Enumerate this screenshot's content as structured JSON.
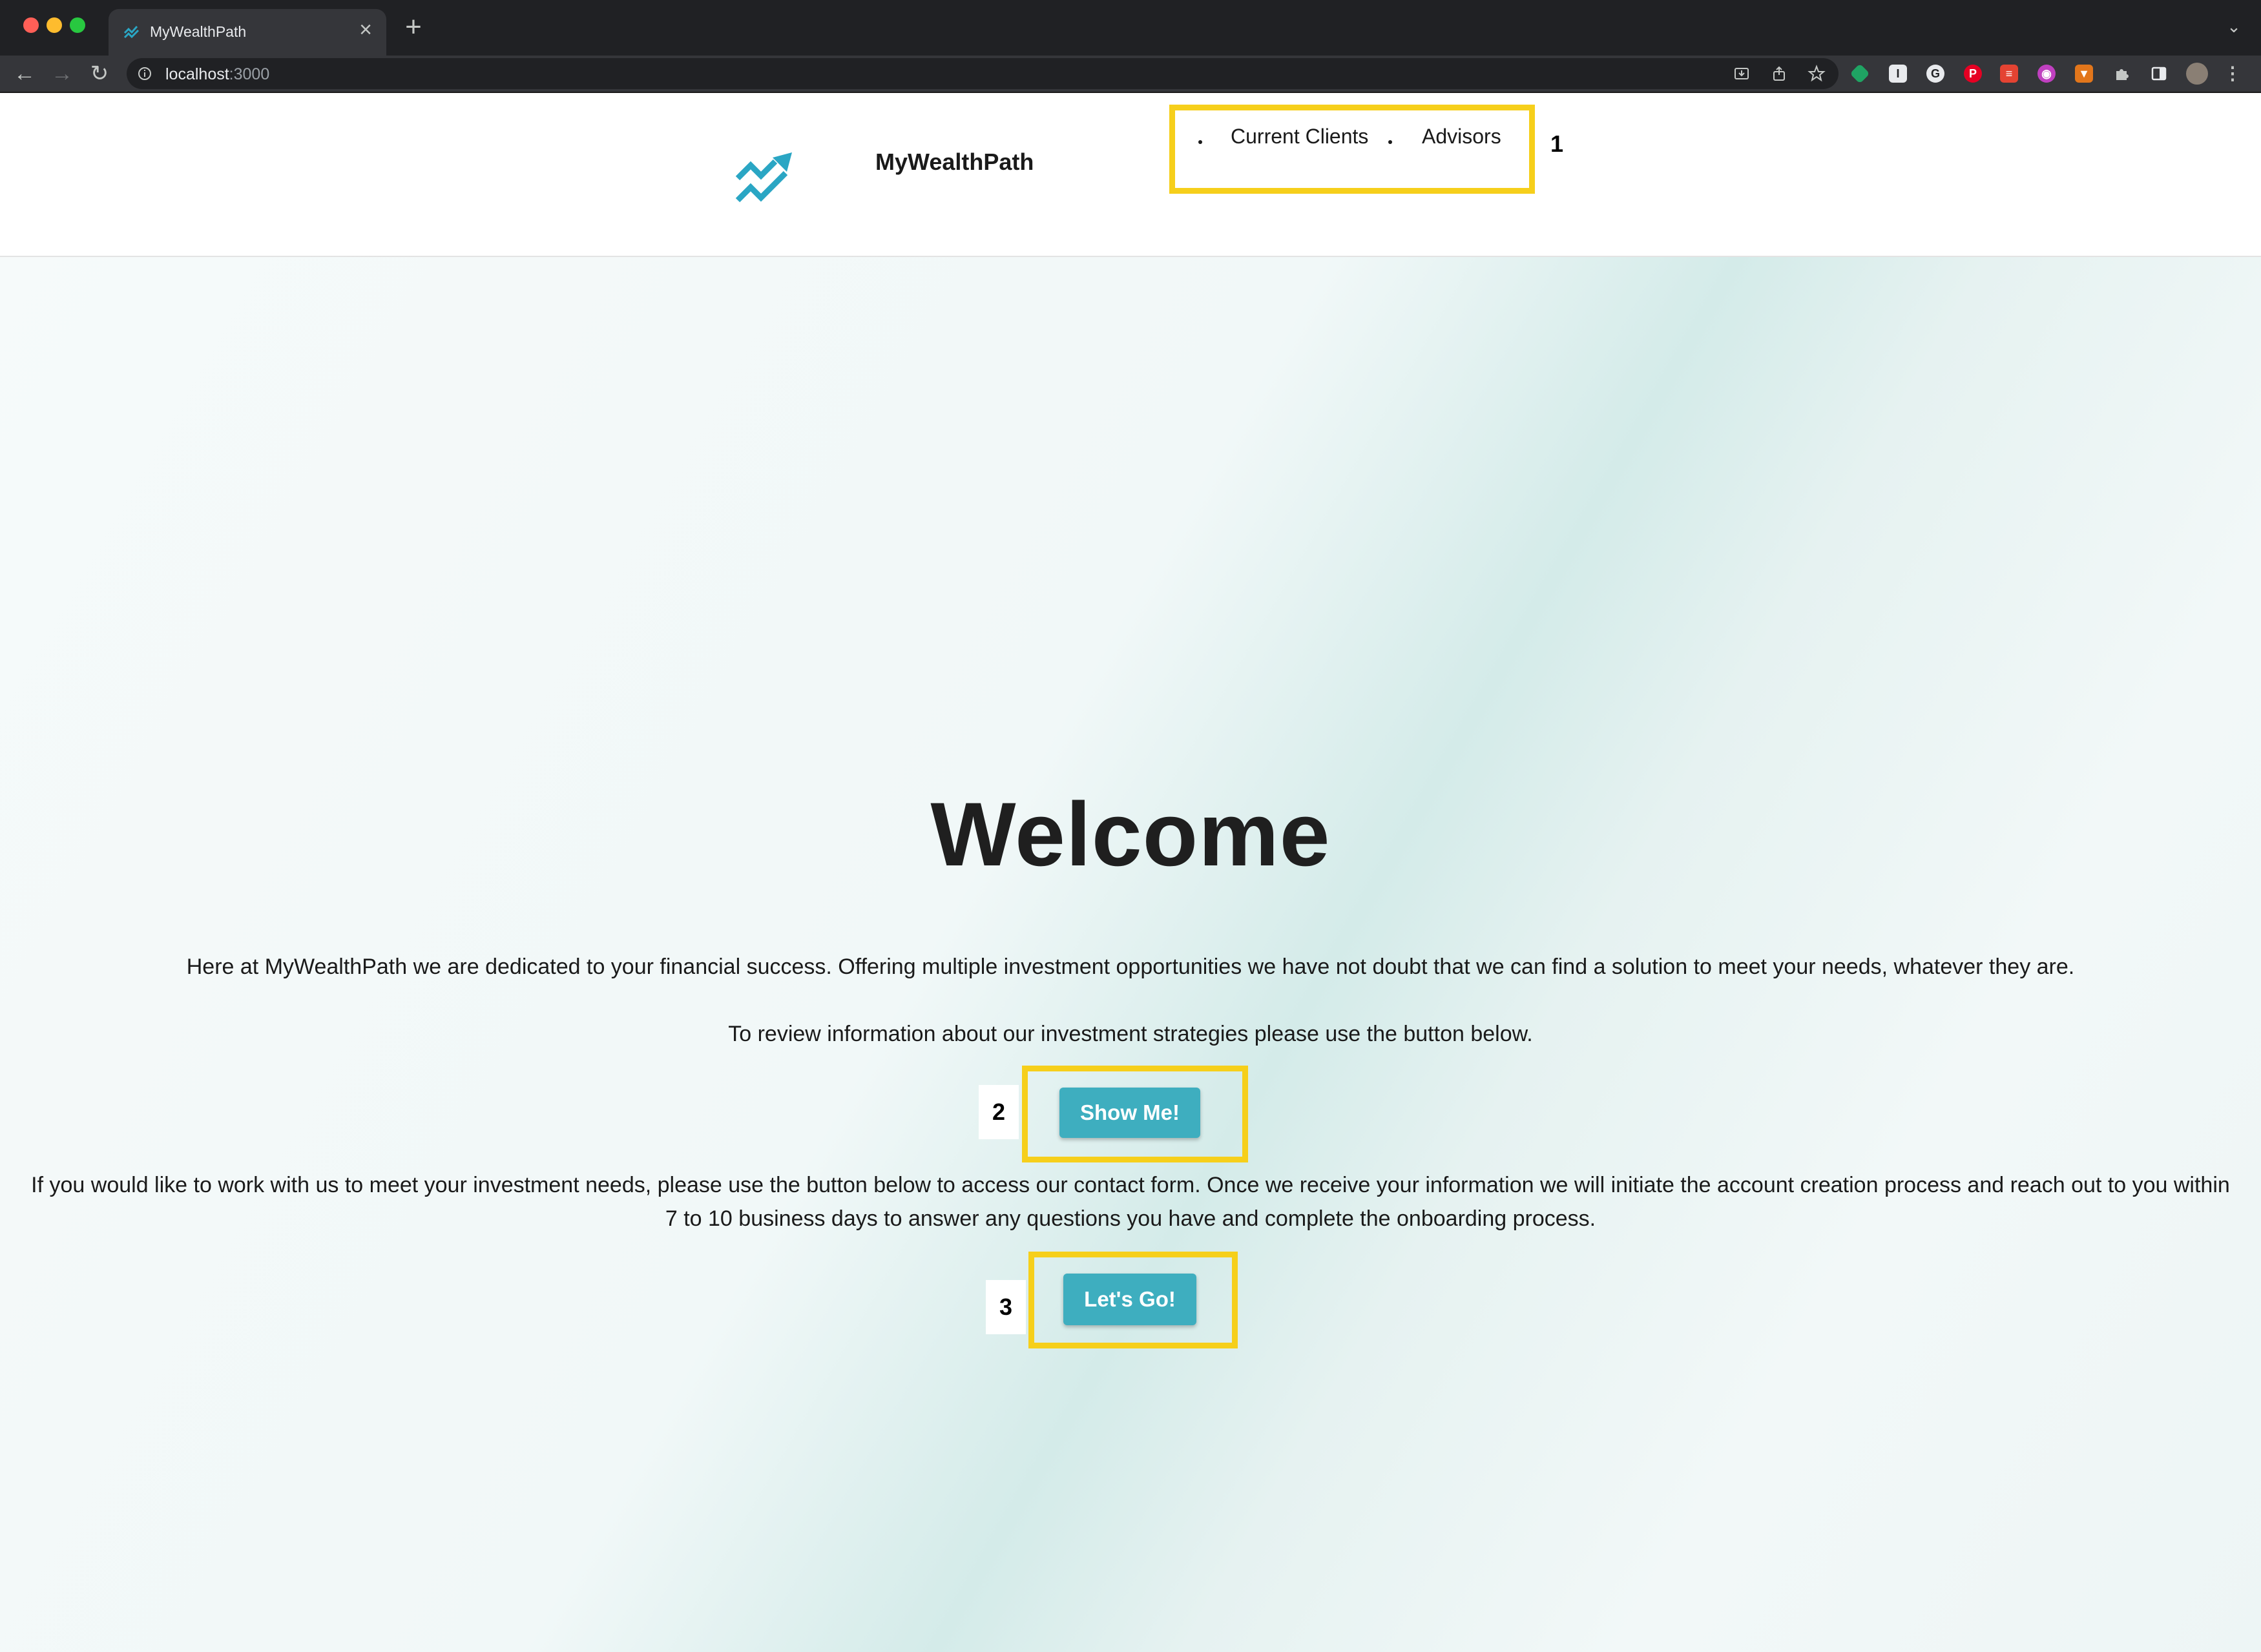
{
  "browser": {
    "tab_title": "MyWealthPath",
    "tab_close": "×",
    "new_tab": "+",
    "tab_dropdown": "⌄",
    "back": "←",
    "forward": "→",
    "reload": "↻",
    "url_host": "localhost",
    "url_port": ":3000",
    "toolbar_icons": [
      "install-icon",
      "share-icon",
      "star-icon"
    ],
    "extensions": [
      "green-ext",
      "I",
      "G",
      "P",
      "red-ext",
      "purple-ext",
      "fox-ext",
      "puzzle",
      "sidepanel",
      "avatar",
      "menu"
    ]
  },
  "header": {
    "brand": "MyWealthPath",
    "nav": [
      {
        "label": "Current Clients"
      },
      {
        "label": "Advisors"
      }
    ],
    "annotation": "1"
  },
  "hero": {
    "title": "Welcome",
    "intro": "Here at MyWealthPath we are dedicated to your financial success. Offering multiple investment opportunities we have not doubt that we can find a solution to meet your needs, whatever they are.",
    "strategies_text": "To review information about our investment strategies please use the button below.",
    "show_me_label": "Show Me!",
    "show_me_annotation": "2",
    "contact_text": "If you would like to work with us to meet your investment needs, please use the button below to access our contact form. Once we receive your information we will initiate the account creation process and reach out to you within 7 to 10 business days to answer any questions you have and complete the onboarding process.",
    "lets_go_label": "Let's Go!",
    "lets_go_annotation": "3"
  },
  "colors": {
    "accent": "#3eaebf",
    "highlight": "#f6cf1b",
    "logo": "#2aa6c4"
  }
}
